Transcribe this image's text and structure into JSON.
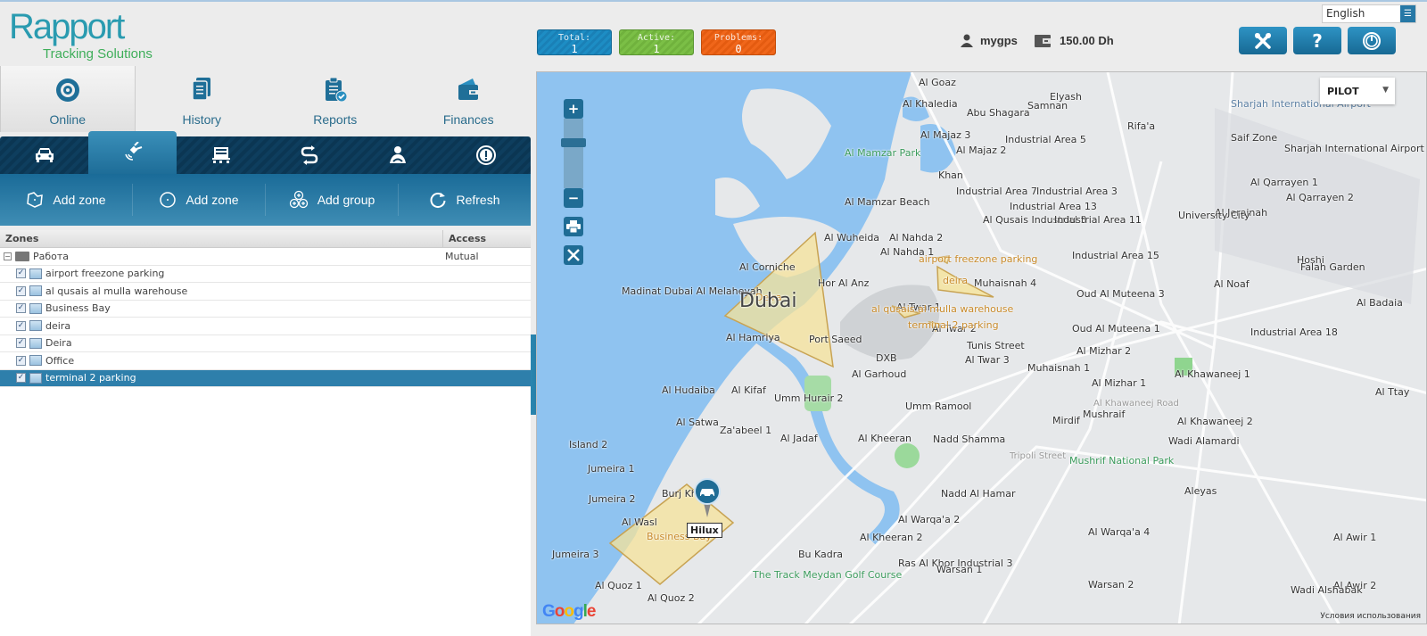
{
  "app": {
    "logo_main": "Rapport",
    "logo_sub": "Tracking Solutions"
  },
  "topnav": [
    {
      "label": "Online",
      "icon": "target-icon",
      "active": true
    },
    {
      "label": "History",
      "icon": "documents-icon"
    },
    {
      "label": "Reports",
      "icon": "clipboard-check-icon"
    },
    {
      "label": "Finances",
      "icon": "wallet-icon"
    }
  ],
  "status": {
    "total_label": "Total:",
    "total_value": "1",
    "active_label": "Active:",
    "active_value": "1",
    "problems_label": "Problems:",
    "problems_value": "0",
    "colors": {
      "total": "#1d8dc4",
      "active": "#7bbf46",
      "problems": "#f0661a"
    }
  },
  "user": {
    "name": "mygps",
    "balance": "150.00 Dh"
  },
  "language": {
    "selected": "English"
  },
  "toolbar_icons": [
    "tools-icon",
    "help-icon",
    "power-icon"
  ],
  "toolbar_help_label": "?",
  "tabs": [
    {
      "icon": "car-icon"
    },
    {
      "icon": "satellite-icon",
      "active": true
    },
    {
      "icon": "truck-front-icon"
    },
    {
      "icon": "route-arrows-icon"
    },
    {
      "icon": "driver-icon"
    },
    {
      "icon": "alert-icon"
    }
  ],
  "actions": [
    {
      "label": "Add zone",
      "icon": "polygon-zone-icon"
    },
    {
      "label": "Add zone",
      "icon": "circle-zone-icon"
    },
    {
      "label": "Add group",
      "icon": "group-icon"
    },
    {
      "label": "Refresh",
      "icon": "refresh-icon"
    }
  ],
  "zones_table": {
    "headers": {
      "zones": "Zones",
      "access": "Access"
    },
    "group": {
      "name": "Работа",
      "access": "Mutual",
      "expander": "−"
    },
    "items": [
      {
        "name": "airport freezone parking",
        "checked": true
      },
      {
        "name": "al qusais al mulla warehouse",
        "checked": true
      },
      {
        "name": "Business Bay",
        "checked": true
      },
      {
        "name": "deira",
        "checked": true
      },
      {
        "name": "Deira",
        "checked": true
      },
      {
        "name": "Office",
        "checked": true
      },
      {
        "name": "terminal 2 parking",
        "checked": true,
        "selected": true
      }
    ],
    "check_glyph": "✓"
  },
  "map": {
    "layer_select": "PILOT",
    "zoom_in": "+",
    "zoom_out": "−",
    "vehicle_label": "Hilux",
    "google": "Google",
    "terms": "Условия использования",
    "city_label": "Dubai",
    "labels": [
      {
        "t": "Al Goaz"
      },
      {
        "t": "Elyash"
      },
      {
        "t": "Al Khaledia"
      },
      {
        "t": "Abu Shagara"
      },
      {
        "t": "Samnan"
      },
      {
        "t": "Rifa'a"
      },
      {
        "t": "Al Majaz 3"
      },
      {
        "t": "Al Majaz 2"
      },
      {
        "t": "Industrial Area 5"
      },
      {
        "t": "Al Mamzar Park"
      },
      {
        "t": "Khan"
      },
      {
        "t": "Industrial Area 7"
      },
      {
        "t": "Industrial Area 3"
      },
      {
        "t": "Industrial Area 13"
      },
      {
        "t": "Al Mamzar Beach"
      },
      {
        "t": "Al Qusais Industrial 3"
      },
      {
        "t": "Industrial Area 11"
      },
      {
        "t": "Industrial Area 15"
      },
      {
        "t": "Al Wuheida"
      },
      {
        "t": "Al Nahda 2"
      },
      {
        "t": "Al Nahda 1"
      },
      {
        "t": "Al Corniche"
      },
      {
        "t": "Hor Al Anz"
      },
      {
        "t": "Muhaisnah 4"
      },
      {
        "t": "Madinat Dubai Al Melaheyah"
      },
      {
        "t": "Al Twar 1"
      },
      {
        "t": "Al Twar 2"
      },
      {
        "t": "Oud Al Muteena 3"
      },
      {
        "t": "Oud Al Muteena 1"
      },
      {
        "t": "Al Hamriya"
      },
      {
        "t": "Port Saeed"
      },
      {
        "t": "DXB"
      },
      {
        "t": "Al Garhoud"
      },
      {
        "t": "Al Twar 3"
      },
      {
        "t": "Muhaisnah 1"
      },
      {
        "t": "Al Mizhar 2"
      },
      {
        "t": "Al Mizhar 1"
      },
      {
        "t": "Al Hudaiba"
      },
      {
        "t": "Al Kifaf"
      },
      {
        "t": "Umm Hurair 2"
      },
      {
        "t": "Umm Ramool"
      },
      {
        "t": "Mirdif"
      },
      {
        "t": "Mushraif"
      },
      {
        "t": "Al Khawaneej 1"
      },
      {
        "t": "Al Khawaneej 2"
      },
      {
        "t": "Al Satwa"
      },
      {
        "t": "Za'abeel 1"
      },
      {
        "t": "Al Jadaf"
      },
      {
        "t": "Al Kheeran"
      },
      {
        "t": "Nadd Shamma"
      },
      {
        "t": "Mushrif National Park"
      },
      {
        "t": "Wadi Alamardi"
      },
      {
        "t": "Island 2"
      },
      {
        "t": "Jumeira 1"
      },
      {
        "t": "Jumeira 2"
      },
      {
        "t": "Burj Khalifa"
      },
      {
        "t": "Al Wasl"
      },
      {
        "t": "Nadd Al Hamar"
      },
      {
        "t": "Al Warqa'a 2"
      },
      {
        "t": "Al Warqa'a 4"
      },
      {
        "t": "Aleyas"
      },
      {
        "t": "Jumeira 3"
      },
      {
        "t": "Al Kheeran 2"
      },
      {
        "t": "Bu Kadra"
      },
      {
        "t": "Ras Al Khor Industrial 3"
      },
      {
        "t": "Warsan 1"
      },
      {
        "t": "Warsan 2"
      },
      {
        "t": "Al Awir 1"
      },
      {
        "t": "Al Awir 2"
      },
      {
        "t": "Al Quoz 1"
      },
      {
        "t": "Al Quoz 2"
      },
      {
        "t": "The Track Meydan Golf Course"
      },
      {
        "t": "Wadi Alshabak"
      },
      {
        "t": "Sharjah International Airport"
      },
      {
        "t": "Saif Zone"
      },
      {
        "t": "Sharjah International Airport"
      },
      {
        "t": "Al Qarrayen 1"
      },
      {
        "t": "Al Qarrayen 2"
      },
      {
        "t": "Al Jerainah"
      },
      {
        "t": "University City"
      },
      {
        "t": "Hoshi"
      },
      {
        "t": "Falah Garden"
      },
      {
        "t": "Al Noaf"
      },
      {
        "t": "Al Badaia"
      },
      {
        "t": "Industrial Area 18"
      },
      {
        "t": "Al Ttay"
      },
      {
        "t": "Tunis Street"
      },
      {
        "t": "Al Khawaneej Road"
      },
      {
        "t": "Tripoli Street"
      }
    ],
    "zone_labels": [
      "Deira",
      "deira",
      "al qusais al mulla warehouse",
      "terminal 2 parking",
      "airport freezone parking",
      "Business Bay"
    ]
  }
}
